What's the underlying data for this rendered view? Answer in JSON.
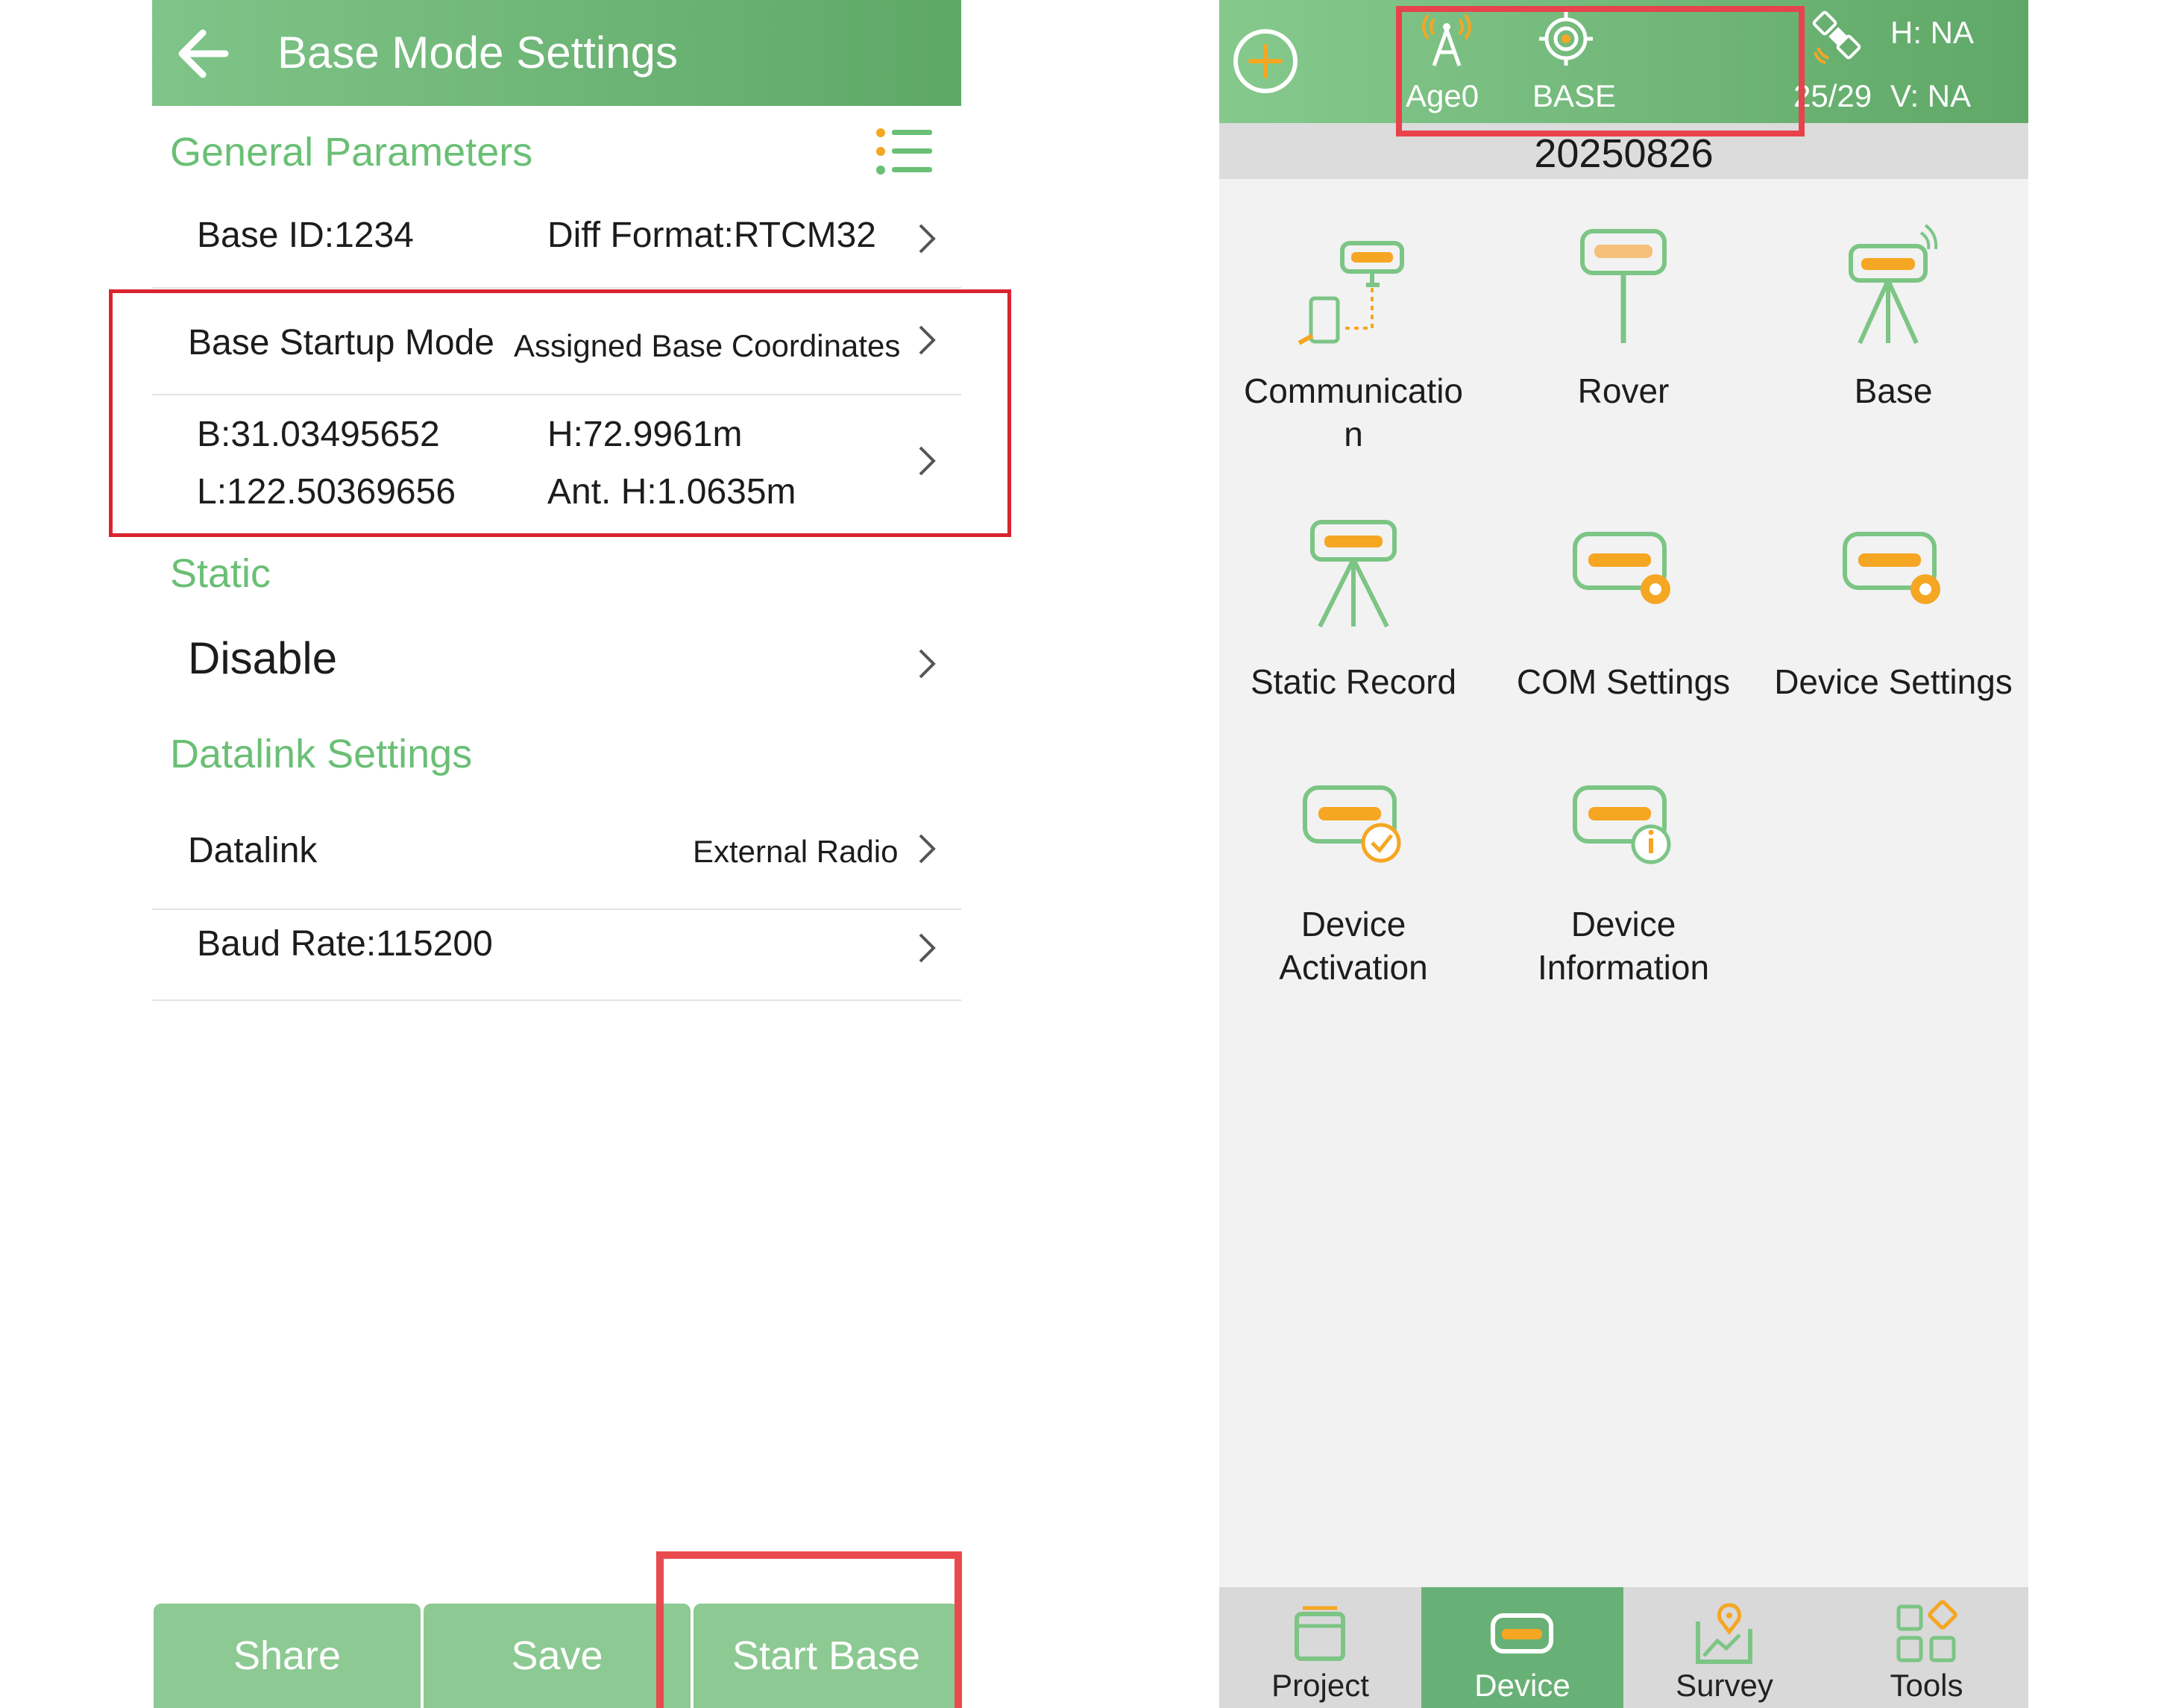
{
  "left": {
    "header": {
      "title": "Base Mode Settings"
    },
    "sections": {
      "general": "General Parameters",
      "static": "Static",
      "datalink": "Datalink Settings"
    },
    "general": {
      "base_id": "Base ID:1234",
      "diff_format": "Diff Format:RTCM32",
      "startup_mode_label": "Base Startup Mode",
      "startup_mode_value": "Assigned Base Coordinates",
      "b": "B:31.03495652",
      "l": "L:122.50369656",
      "h": "H:72.9961m",
      "ant_h": "Ant. H:1.0635m"
    },
    "static": {
      "value": "Disable"
    },
    "datalink": {
      "label": "Datalink",
      "value": "External Radio",
      "baud_rate": "Baud Rate:115200"
    },
    "buttons": {
      "share": "Share",
      "save": "Save",
      "start_base": "Start Base"
    }
  },
  "right": {
    "status": {
      "age": "Age0",
      "mode": "BASE",
      "satellites": "25/29",
      "h": "H: NA",
      "v": "V: NA"
    },
    "date": "20250826",
    "tiles": [
      {
        "label": "Communicatio n",
        "icon": "communication-icon"
      },
      {
        "label": "Rover",
        "icon": "rover-icon"
      },
      {
        "label": "Base",
        "icon": "base-icon"
      },
      {
        "label": "Static Record",
        "icon": "static-record-icon"
      },
      {
        "label": "COM Settings",
        "icon": "com-settings-icon"
      },
      {
        "label": "Device Settings",
        "icon": "device-settings-icon"
      },
      {
        "label": "Device Activation",
        "icon": "device-activation-icon"
      },
      {
        "label": "Device Information",
        "icon": "device-information-icon"
      }
    ],
    "nav": [
      {
        "label": "Project",
        "icon": "project-icon",
        "active": false
      },
      {
        "label": "Device",
        "icon": "device-icon",
        "active": true
      },
      {
        "label": "Survey",
        "icon": "survey-icon",
        "active": false
      },
      {
        "label": "Tools",
        "icon": "tools-icon",
        "active": false
      }
    ],
    "colors": {
      "header_green": "#5fa867",
      "accent_orange": "#f5a623",
      "icon_green": "#7cc585",
      "highlight_red": "#e0323d"
    }
  }
}
